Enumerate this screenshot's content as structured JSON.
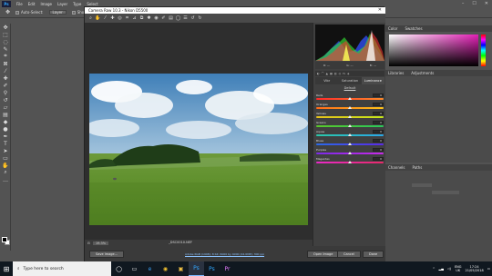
{
  "ps": {
    "logo": "Ps",
    "menu": [
      "File",
      "Edit",
      "Image",
      "Layer",
      "Type",
      "Select"
    ],
    "options": {
      "auto_select_label": "Auto-Select:",
      "auto_select_value": "Layer",
      "show_transform_label": "Show Transform Controls"
    },
    "window_controls": [
      "–",
      "☐",
      "✕"
    ],
    "right_panels": {
      "color_tab": "Color",
      "swatches_tab": "Swatches",
      "libraries_tab": "Libraries",
      "adjustments_tab": "Adjustments",
      "channels_tab": "Channels",
      "paths_tab": "Paths"
    },
    "colors": {
      "fg": "#000000",
      "bg": "#ffffff"
    }
  },
  "camera_raw": {
    "title": "Camera Raw 10.3  -  Nikon D5500",
    "close_glyph": "✕",
    "zoom": "19.3%",
    "filename": "_DSC0010.NEF",
    "histogram_values": [
      "R: ---",
      "G: ---",
      "B: ---",
      "f/8  1/400 s",
      "ISO 100  18-55@18 mm"
    ],
    "tabs_small": [
      "Fit",
      "Detail",
      "HSL",
      "Split",
      "Lens"
    ],
    "panel_tabs": [
      "Vibr",
      "Saturation",
      "Luminance"
    ],
    "panel_title": "HSL Adjustments",
    "default_link": "Default",
    "sliders": [
      {
        "label": "Reds",
        "value": "0",
        "pos": 0.5
      },
      {
        "label": "Oranges",
        "value": "0",
        "pos": 0.5
      },
      {
        "label": "Yellows",
        "value": "0",
        "pos": 0.5
      },
      {
        "label": "Greens",
        "value": "0",
        "pos": 0.5
      },
      {
        "label": "Aquas",
        "value": "0",
        "pos": 0.5
      },
      {
        "label": "Blues",
        "value": "0",
        "pos": 0.5
      },
      {
        "label": "Purples",
        "value": "0",
        "pos": 0.5
      },
      {
        "label": "Magentas",
        "value": "0",
        "pos": 0.5
      }
    ],
    "workflow_link": "Adobe RGB (1998); 8 bit; 6000 by 4000 (24.0MP); 300 ppi",
    "buttons": {
      "save": "Save Image...",
      "open": "Open Image",
      "cancel": "Cancel",
      "done": "Done"
    }
  },
  "taskbar": {
    "start_glyph": "⊞",
    "search_placeholder": "Type here to search",
    "apps": [
      "◯",
      "▭",
      "e",
      "◉",
      "▣",
      "Ps",
      "Ps",
      "Pr"
    ],
    "tray_lang_top": "ENG",
    "tray_lang_bottom": "UK",
    "time": "17:24",
    "date": "21/05/2018"
  }
}
